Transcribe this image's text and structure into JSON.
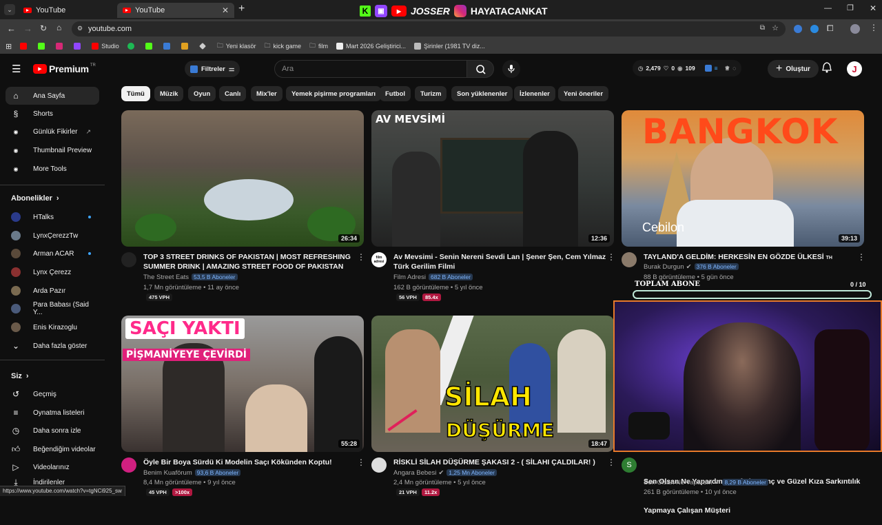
{
  "browser": {
    "tabs": [
      {
        "title": "YouTube"
      },
      {
        "title": "YouTube"
      }
    ],
    "new_tab": "+",
    "url": "youtube.com",
    "bookmarks": [
      "Studio",
      "Yeni klasör",
      "kick game",
      "film",
      "Mart 2026 Geliştirici...",
      "Şirinler (1981 TV diz..."
    ],
    "status_url": "https://www.youtube.com/watch?v=tgNCi925_sw"
  },
  "overlay": {
    "channel_left": "JOSSER",
    "channel_right": "HAYATACANKAT"
  },
  "header": {
    "logo_text": "Premium",
    "logo_badge": "TR",
    "filter_label": "Filtreler",
    "search_placeholder": "Ara",
    "stats": {
      "views": "2,479",
      "likes": "0",
      "watch": "109"
    },
    "create_label": "Oluştur",
    "avatar_letter": "J"
  },
  "sidebar": {
    "main": [
      {
        "label": "Ana Sayfa"
      },
      {
        "label": "Shorts"
      },
      {
        "label": "Günlük Fikirler"
      },
      {
        "label": "Thumbnail Preview"
      },
      {
        "label": "More Tools"
      }
    ],
    "subs_title": "Abonelikler",
    "subs": [
      {
        "label": "HTalks",
        "color": "#2a3a8a"
      },
      {
        "label": "LynxÇerezzTw",
        "color": "#6a7a8a"
      },
      {
        "label": "Arman ACAR",
        "color": "#5a4a3a"
      },
      {
        "label": "Lynx Çerezz",
        "color": "#8a3030"
      },
      {
        "label": "Arda Pazır",
        "color": "#7a6a50"
      },
      {
        "label": "Para Babası (Said Y...",
        "color": "#4a5a7a"
      },
      {
        "label": "Enis Kirazoglu",
        "color": "#6a5a4a"
      },
      {
        "label": "Daha fazla göster"
      }
    ],
    "you_title": "Siz",
    "you": [
      {
        "label": "Geçmiş"
      },
      {
        "label": "Oynatma listeleri"
      },
      {
        "label": "Daha sonra izle"
      },
      {
        "label": "Beğendiğim videolar"
      },
      {
        "label": "Videolarınız"
      },
      {
        "label": "İndirilenler"
      }
    ]
  },
  "chips": [
    "Tümü",
    "Müzik",
    "Oyun",
    "Canlı",
    "Mix'ler",
    "Yemek pişirme programları",
    "Futbol",
    "Turizm",
    "Son yüklenenler",
    "İzlenenler",
    "Yeni öneriler"
  ],
  "videos": [
    {
      "title1": "TOP 3 STREET DRINKS OF PAKISTAN | MOST REFRESHING",
      "title2": "SUMMER DRINK | AMAZING STREET FOOD OF PAKISTAN",
      "channel": "The Street Eats",
      "subs": "53,5 B Aboneler",
      "meta": "1,7 Mn görüntüleme • 11 ay önce",
      "duration": "26:34",
      "vph": "475 VPH",
      "mult": ""
    },
    {
      "title1": "Av Mevsimi - Senin Nereni Sevdi Lan | Şener Şen, Cem Yılmaz",
      "title2": "Türk Gerilim Filmi",
      "channel": "Film Adresi",
      "subs": "682 B Aboneler",
      "meta": "162 B görüntüleme • 5 yıl önce",
      "duration": "12:36",
      "vph": "56 VPH",
      "mult": "85.4x",
      "thumb_text": "AV MEVSİMİ",
      "avatar_text": "film adresi"
    },
    {
      "title1": "TAYLAND'A GELDİM: HERKESİN EN GÖZDE ÜLKESİ",
      "title2": "",
      "title_suffix": "TH",
      "channel": "Burak Durgun",
      "subs": "376 B Aboneler",
      "meta": "88 B görüntüleme • 5 gün önce",
      "duration": "39:13",
      "thumb_text": "BANGKOK",
      "watermark": "Cebilon"
    },
    {
      "title1": "Öyle Bir Boya Sürdü Ki Modelin Saçı Kökünden Koptu!",
      "title2": "",
      "channel": "Benim Kuaförum",
      "subs": "93,6 B Aboneler",
      "meta": "8,4 Mn görüntüleme • 9 yıl önce",
      "duration": "55:28",
      "vph": "45 VPH",
      "mult": ">100x",
      "thumb_text1": "SAÇI YAKTI",
      "thumb_text2": "PİŞMANİYEYE ÇEVİRDİ"
    },
    {
      "title1": "RİSKLİ SİLAH DÜŞÜRME ŞAKASI 2 - ( SİLAHI ÇALDILAR! )",
      "title2": "",
      "channel": "Angara Bebesi",
      "subs": "1,25 Mn Aboneler",
      "meta": "2,4 Mn görüntüleme • 5 yıl önce",
      "duration": "18:47",
      "vph": "21 VPH",
      "mult": "11.2x",
      "thumb_text1": "SİLAH",
      "thumb_text2": "DÜŞÜRME"
    },
    {
      "title1": "Sen Olsan Ne Yapardın    Kafede Genç ve Güzel Kıza Sarkıntılık",
      "title2": "Yapmaya Çalışan Müşteri",
      "channel": "Sen Olsan Ne Yapardın",
      "subs": "8,29 B Aboneler",
      "meta": "261 B görüntüleme • 10 yıl önce",
      "avatar_letter": "S"
    }
  ],
  "sub_goal": {
    "label": "TOPLAM ABONE",
    "value": "0 / 10",
    "progress": 0
  }
}
